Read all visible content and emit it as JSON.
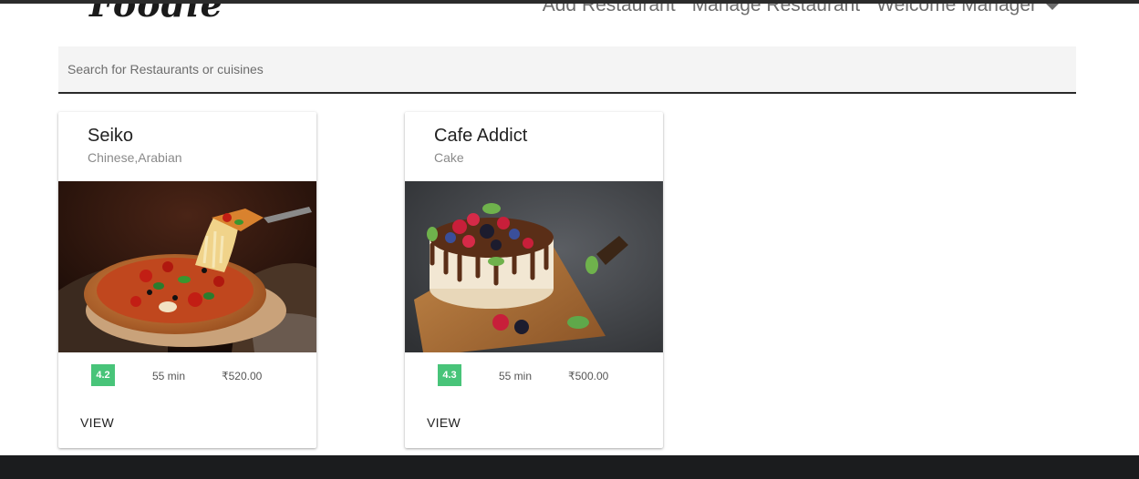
{
  "brand": {
    "logo": "Foodie"
  },
  "nav": {
    "add_restaurant": "Add Restaurant",
    "manage_restaurant": "Manage Restaurant",
    "welcome": "Welcome Manager"
  },
  "search": {
    "placeholder": "Search for Restaurants or cuisines",
    "value": ""
  },
  "colors": {
    "rating_badge": "#48c479",
    "footer": "#1b1c1e",
    "search_bg": "#f4f4f4"
  },
  "restaurants": [
    {
      "name": "Seiko",
      "cuisines": "Chinese,Arabian",
      "image": "pizza-image",
      "rating": "4.2",
      "time": "55 min",
      "price": "₹520.00",
      "action": "VIEW"
    },
    {
      "name": "Cafe Addict",
      "cuisines": "Cake",
      "image": "cake-image",
      "rating": "4.3",
      "time": "55 min",
      "price": "₹500.00",
      "action": "VIEW"
    }
  ]
}
